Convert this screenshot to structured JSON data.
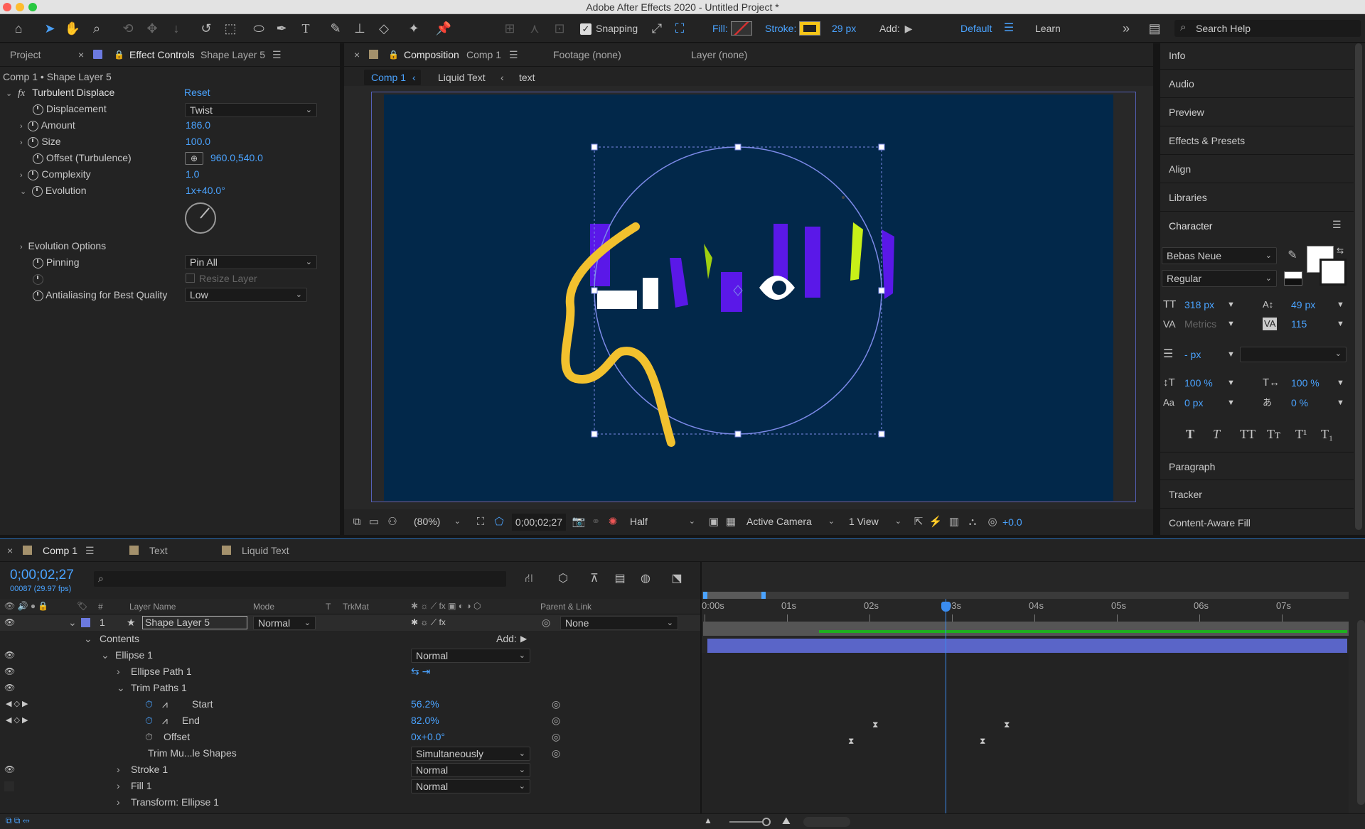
{
  "app": {
    "window_title": "Adobe After Effects 2020 - Untitled Project *"
  },
  "toolbar": {
    "snapping_label": "Snapping",
    "fill_label": "Fill:",
    "stroke_label": "Stroke:",
    "stroke_width": "29 px",
    "add_label": "Add:",
    "workspace_default": "Default",
    "workspace_learn": "Learn",
    "search_placeholder": "Search Help"
  },
  "left_panel": {
    "tab_project": "Project",
    "tab_effect_controls": "Effect Controls",
    "tab_effect_layer": "Shape Layer 5",
    "breadcrumb": "Comp 1 • Shape Layer 5",
    "effect_name": "Turbulent Displace",
    "reset_label": "Reset",
    "props": [
      {
        "label": "Displacement",
        "value": "Twist"
      },
      {
        "label": "Amount",
        "value": "186.0"
      },
      {
        "label": "Size",
        "value": "100.0"
      },
      {
        "label": "Offset (Turbulence)",
        "value": "960.0,540.0"
      },
      {
        "label": "Complexity",
        "value": "1.0"
      },
      {
        "label": "Evolution",
        "value": "1x+40.0°"
      },
      {
        "label": "Evolution Options",
        "value": ""
      },
      {
        "label": "Pinning",
        "value": "Pin All"
      },
      {
        "label": "Resize Layer",
        "value": ""
      },
      {
        "label": "Antialiasing for Best Quality",
        "value": "Low"
      }
    ]
  },
  "comp_panel": {
    "tab_composition": "Composition",
    "tab_comp_name": "Comp 1",
    "tab_footage": "Footage (none)",
    "tab_layer": "Layer (none)",
    "crumbs": [
      "Comp 1",
      "Liquid Text",
      "text"
    ],
    "zoom": "(80%)",
    "timecode": "0;00;02;27",
    "resolution": "Half",
    "camera": "Active Camera",
    "views": "1 View",
    "exposure": "+0.0",
    "canvas_bg": "#02284a"
  },
  "right_panel": {
    "items": [
      "Info",
      "Audio",
      "Preview",
      "Effects & Presets",
      "Align",
      "Libraries"
    ],
    "character_title": "Character",
    "font": "Bebas Neue",
    "style": "Regular",
    "font_size": "318 px",
    "leading": "49 px",
    "kerning": "Metrics",
    "tracking": "115",
    "stroke_px": "- px",
    "vscale": "100 %",
    "hscale": "100 %",
    "baseline": "0 px",
    "tsume": "0 %",
    "bottom_items": [
      "Paragraph",
      "Tracker",
      "Content-Aware Fill"
    ]
  },
  "timeline": {
    "tabs": [
      "Comp 1",
      "Text",
      "Liquid Text"
    ],
    "timecode": "0;00;02;27",
    "frame_info": "00087 (29.97 fps)",
    "col_headers": {
      "num": "#",
      "layer_name": "Layer Name",
      "mode": "Mode",
      "t": "T",
      "trkmat": "TrkMat",
      "parent": "Parent & Link"
    },
    "layer": {
      "num": "1",
      "name": "Shape Layer 5",
      "mode": "Normal",
      "parent": "None"
    },
    "contents_label": "Contents",
    "add_label": "Add:",
    "rows": [
      {
        "label": "Ellipse 1",
        "value": "Normal"
      },
      {
        "label": "Ellipse Path 1",
        "value": ""
      },
      {
        "label": "Trim Paths 1",
        "value": ""
      },
      {
        "label": "Start",
        "value": "56.2%"
      },
      {
        "label": "End",
        "value": "82.0%"
      },
      {
        "label": "Offset",
        "value": "0x+0.0°"
      },
      {
        "label": "Trim Mu...le Shapes",
        "value": "Simultaneously"
      },
      {
        "label": "Stroke 1",
        "value": "Normal"
      },
      {
        "label": "Fill 1",
        "value": "Normal"
      },
      {
        "label": "Transform: Ellipse 1",
        "value": ""
      }
    ],
    "ruler": [
      "0:00s",
      "01s",
      "02s",
      "03s",
      "04s",
      "05s",
      "06s",
      "07s"
    ]
  }
}
